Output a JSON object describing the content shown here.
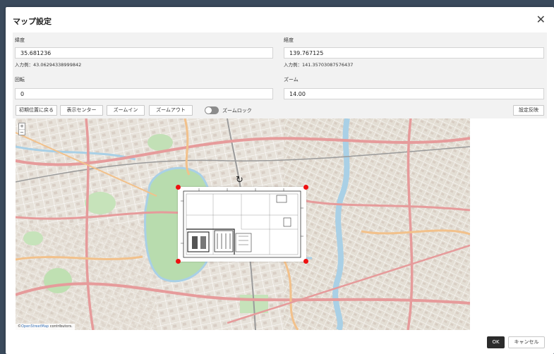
{
  "dialog": {
    "title": "マップ設定"
  },
  "form": {
    "lat_label": "緯度",
    "lat_value": "35.681236",
    "lat_hint": "入力例：43.06294338999842",
    "lng_label": "経度",
    "lng_value": "139.767125",
    "lng_hint": "入力例：141.35703087576437",
    "rotation_label": "回転",
    "rotation_value": "0",
    "zoom_label": "ズーム",
    "zoom_value": "14.00"
  },
  "toolbar": {
    "reset_position": "初期位置に戻る",
    "center": "表示センター",
    "zoom_in": "ズームイン",
    "zoom_out": "ズームアウト",
    "zoom_lock": "ズームロック",
    "apply_settings": "設定反映"
  },
  "map": {
    "zoom_in_symbol": "+",
    "zoom_out_symbol": "−",
    "attribution_prefix": "©",
    "attribution_link": "OpenStreetMap",
    "attribution_suffix": " contributors."
  },
  "footer": {
    "ok": "OK",
    "cancel": "キャンセル"
  },
  "colors": {
    "handle": "#ee1111",
    "ok_button": "#2b2b2b",
    "park": "#b8dcae",
    "water": "#a9d0e6",
    "major_road": "#e69b9b"
  }
}
